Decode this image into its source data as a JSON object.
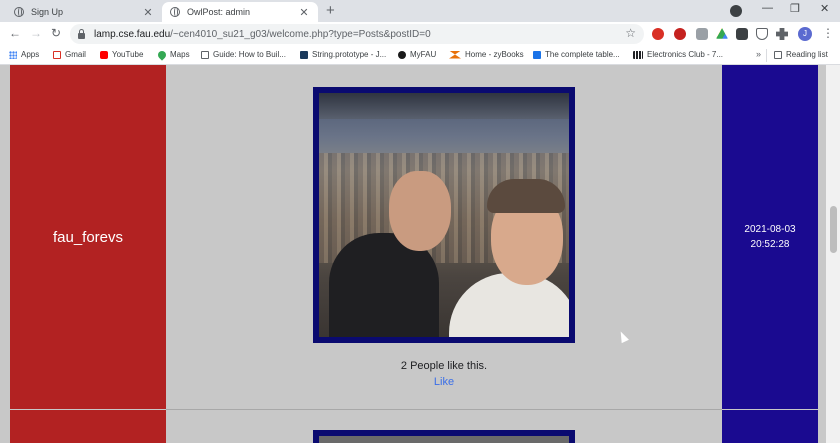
{
  "browser": {
    "tabs": [
      {
        "title": "Sign Up",
        "active": false
      },
      {
        "title": "OwlPost: admin",
        "active": true
      }
    ],
    "url": {
      "host": "lamp.cse.fau.edu",
      "path": "/~cen4010_su21_g03/welcome.php?type=Posts&postID=0"
    },
    "bookmarks": [
      {
        "label": "Apps",
        "icon": "apps-grid-icon",
        "color": "#4285f4"
      },
      {
        "label": "Gmail",
        "icon": "gmail-icon",
        "color": "#d93025"
      },
      {
        "label": "YouTube",
        "icon": "youtube-icon",
        "color": "#ff0000"
      },
      {
        "label": "Maps",
        "icon": "maps-pin-icon",
        "color": "#34a853"
      },
      {
        "label": "Guide: How to Buil...",
        "icon": "page-icon",
        "color": "#5f6368"
      },
      {
        "label": "String.prototype - J...",
        "icon": "mdn-icon",
        "color": "#1b3a5c"
      },
      {
        "label": "MyFAU",
        "icon": "owl-icon",
        "color": "#1a1a1a"
      },
      {
        "label": "Home - zyBooks",
        "icon": "zybooks-icon",
        "color": "#e8710a"
      },
      {
        "label": "The complete table...",
        "icon": "bookmark-icon",
        "color": "#1a73e8"
      },
      {
        "label": "Electronics Club - 7...",
        "icon": "club-icon",
        "color": "#202124"
      }
    ],
    "bookmarks_more": "»",
    "reading_list": "Reading list",
    "profile_initial": "J",
    "ext_badge": "+"
  },
  "post": {
    "username": "fau_forevs",
    "date": "2021-08-03",
    "time": "20:52:28",
    "likes_text": "2 People like this.",
    "like_label": "Like"
  },
  "colors": {
    "user_column": "#b22222",
    "date_column": "#1a0a90",
    "photo_frame": "#0a0a70",
    "like_link": "#3a6ee8"
  }
}
